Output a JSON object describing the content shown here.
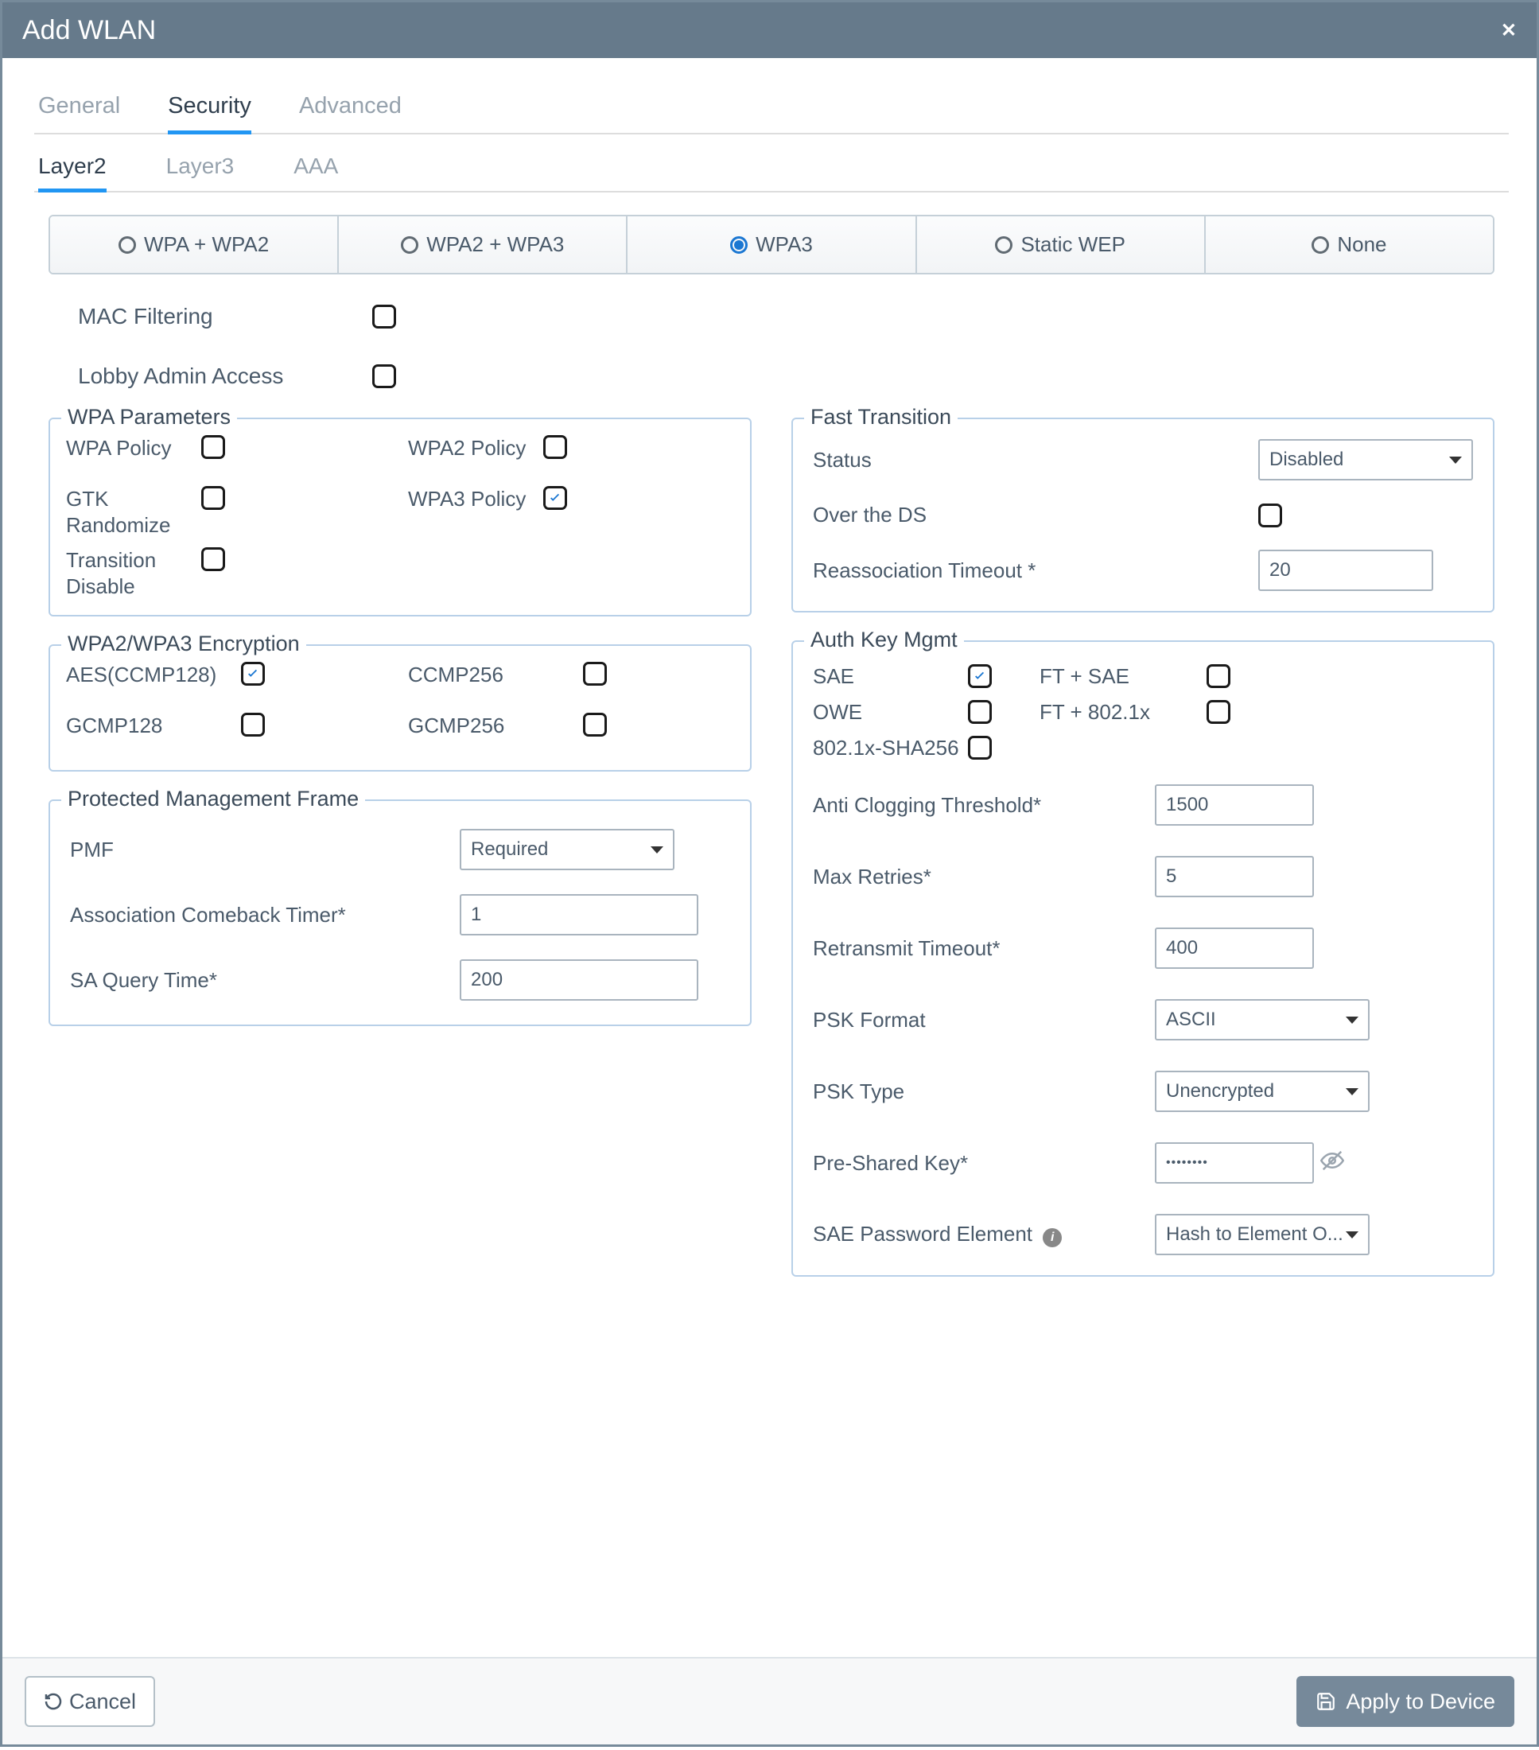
{
  "window": {
    "title": "Add WLAN"
  },
  "tabs": {
    "t0": "General",
    "t1": "Security",
    "t2": "Advanced"
  },
  "subtabs": {
    "s0": "Layer2",
    "s1": "Layer3",
    "s2": "AAA"
  },
  "modes": {
    "m0": "WPA + WPA2",
    "m1": "WPA2 + WPA3",
    "m2": "WPA3",
    "m3": "Static WEP",
    "m4": "None"
  },
  "macFilter": "MAC Filtering",
  "lobbyAdmin": "Lobby Admin Access",
  "wpaParams": {
    "legend": "WPA Parameters",
    "wpaPolicy": "WPA Policy",
    "wpa2Policy": "WPA2 Policy",
    "gtk": "GTK Randomize",
    "wpa3Policy": "WPA3 Policy",
    "transDisable": "Transition Disable"
  },
  "enc": {
    "legend": "WPA2/WPA3 Encryption",
    "aes": "AES(CCMP128)",
    "ccmp256": "CCMP256",
    "gcmp128": "GCMP128",
    "gcmp256": "GCMP256"
  },
  "pmf": {
    "legend": "Protected Management Frame",
    "pmf": "PMF",
    "pmfVal": "Required",
    "assocTimer": "Association Comeback Timer*",
    "assocVal": "1",
    "saQuery": "SA Query Time*",
    "saVal": "200"
  },
  "ft": {
    "legend": "Fast Transition",
    "status": "Status",
    "statusVal": "Disabled",
    "overDS": "Over the DS",
    "reassoc": "Reassociation Timeout *",
    "reassocVal": "20"
  },
  "akm": {
    "legend": "Auth Key Mgmt",
    "sae": "SAE",
    "ftsae": "FT + SAE",
    "owe": "OWE",
    "ft8021x": "FT + 802.1x",
    "sha256": "802.1x-SHA256",
    "antiClog": "Anti Clogging Threshold*",
    "antiClogVal": "1500",
    "maxRetries": "Max Retries*",
    "maxRetriesVal": "5",
    "retrans": "Retransmit Timeout*",
    "retransVal": "400",
    "pskFormat": "PSK Format",
    "pskFormatVal": "ASCII",
    "pskType": "PSK Type",
    "pskTypeVal": "Unencrypted",
    "psk": "Pre-Shared Key*",
    "pskVal": "••••••••",
    "saePwd": "SAE Password Element",
    "saePwdVal": "Hash to Element O..."
  },
  "footer": {
    "cancel": "Cancel",
    "apply": "Apply to Device"
  }
}
